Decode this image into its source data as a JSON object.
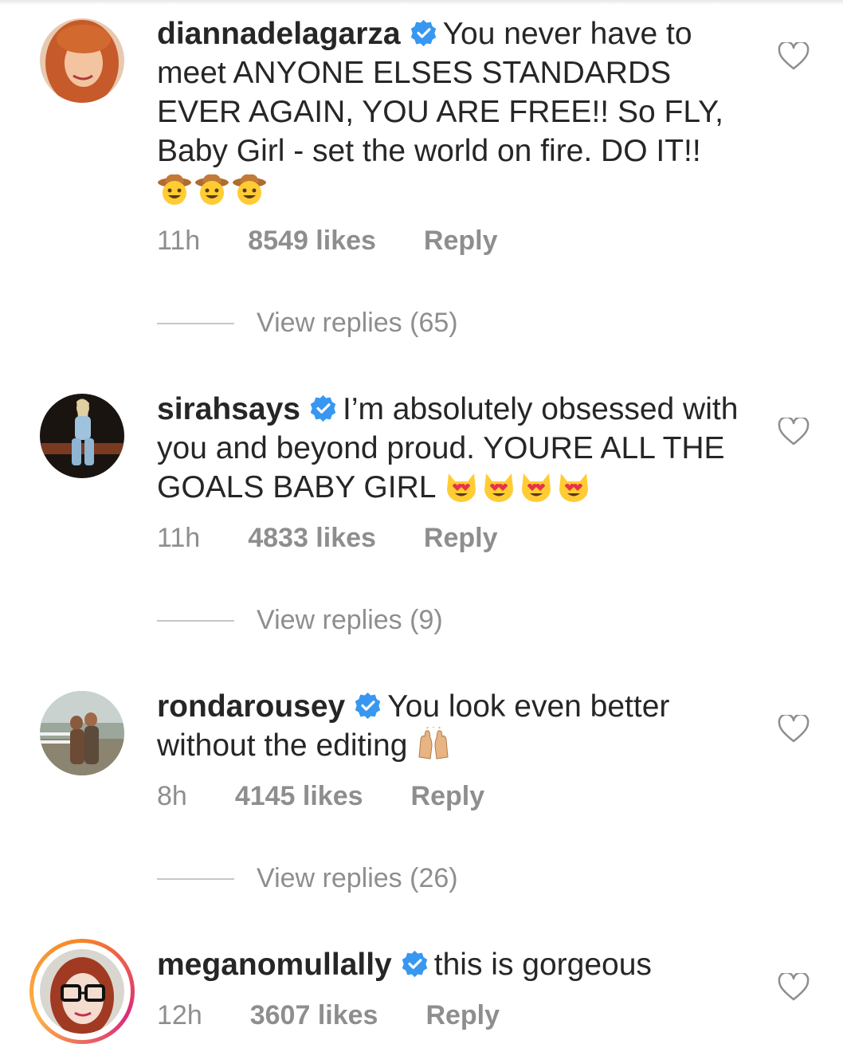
{
  "comments": [
    {
      "username": "diannadelagarza",
      "verified": true,
      "text": "You never have to meet ANYONE ELSES STANDARDS EVER AGAIN, YOU ARE FREE!! So FLY, Baby Girl - set the world on fire. DO IT!!",
      "emojis": [
        "cowboy-face",
        "cowboy-face",
        "cowboy-face"
      ],
      "time": "11h",
      "likes": "8549 likes",
      "reply_label": "Reply",
      "view_replies": "View replies (65)"
    },
    {
      "username": "sirahsays",
      "verified": true,
      "text": "I’m absolutely obsessed with you and beyond proud. YOURE ALL THE GOALS BABY GIRL",
      "emojis": [
        "heart-eyes-cat",
        "heart-eyes-cat",
        "heart-eyes-cat",
        "heart-eyes-cat"
      ],
      "time": "11h",
      "likes": "4833 likes",
      "reply_label": "Reply",
      "view_replies": "View replies (9)"
    },
    {
      "username": "rondarousey",
      "verified": true,
      "text": "You look even better without the editing",
      "emojis": [
        "raising-hands"
      ],
      "time": "8h",
      "likes": "4145 likes",
      "reply_label": "Reply",
      "view_replies": "View replies (26)"
    },
    {
      "username": "meganomullally",
      "verified": true,
      "text": "this is gorgeous",
      "emojis": [],
      "time": "12h",
      "likes": "3607 likes",
      "reply_label": "Reply",
      "has_story_ring": true
    }
  ],
  "colors": {
    "text": "#262626",
    "meta": "#8e8e8e",
    "verified_blue": "#3897f0",
    "divider": "#c7c7c7"
  },
  "icons": {
    "verified": "verified-badge-icon",
    "like": "heart-outline-icon"
  }
}
